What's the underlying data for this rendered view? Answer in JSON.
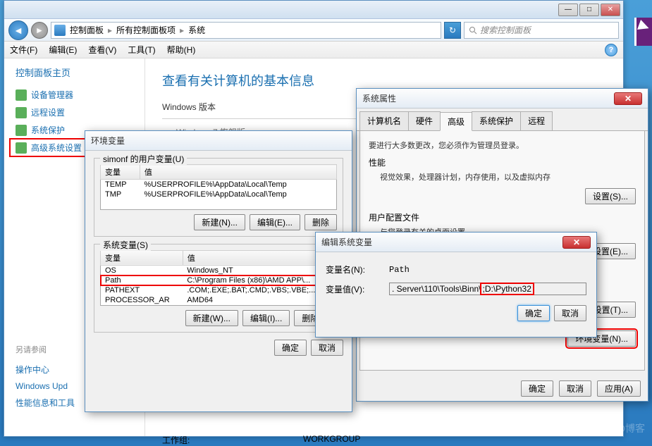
{
  "explorer": {
    "breadcrumb": [
      "控制面板",
      "所有控制面板项",
      "系统"
    ],
    "search_placeholder": "搜索控制面板",
    "menu": [
      "文件(F)",
      "编辑(E)",
      "查看(V)",
      "工具(T)",
      "帮助(H)"
    ]
  },
  "sidebar": {
    "title": "控制面板主页",
    "items": [
      "设备管理器",
      "远程设置",
      "系统保护",
      "高级系统设置"
    ],
    "see_also_title": "另请参阅",
    "see_also": [
      "操作中心",
      "Windows Upd",
      "性能信息和工具"
    ]
  },
  "content": {
    "heading": "查看有关计算机的基本信息",
    "section1": "Windows 版本",
    "edition": "Windows 7 旗舰版",
    "workgroup_label": "工作组:",
    "workgroup_value": "WORKGROUP"
  },
  "sysprop": {
    "title": "系统属性",
    "tabs": [
      "计算机名",
      "硬件",
      "高级",
      "系统保护",
      "远程"
    ],
    "intro": "要进行大多数更改，您必须作为管理员登录。",
    "perf_title": "性能",
    "perf_desc": "视觉效果，处理器计划，内存使用，以及虚拟内存",
    "userprof_title": "用户配置文件",
    "userprof_desc": "与您登录有关的桌面设置",
    "settings_btn": "设置(S)...",
    "settings_btn_e": "设置(E)...",
    "settings_btn_t": "设置(T)...",
    "envvar_btn": "环境变量(N)...",
    "ok": "确定",
    "cancel": "取消",
    "apply": "应用(A)"
  },
  "envvar": {
    "title": "环境变量",
    "user_group": "simonf 的用户变量(U)",
    "sys_group": "系统变量(S)",
    "col_var": "变量",
    "col_val": "值",
    "user_rows": [
      {
        "name": "TEMP",
        "val": "%USERPROFILE%\\AppData\\Local\\Temp"
      },
      {
        "name": "TMP",
        "val": "%USERPROFILE%\\AppData\\Local\\Temp"
      }
    ],
    "sys_rows": [
      {
        "name": "OS",
        "val": "Windows_NT"
      },
      {
        "name": "Path",
        "val": "C:\\Program Files (x86)\\AMD APP\\..."
      },
      {
        "name": "PATHEXT",
        "val": ".COM;.EXE;.BAT;.CMD;.VBS;.VBE;..."
      },
      {
        "name": "PROCESSOR_AR",
        "val": "AMD64"
      }
    ],
    "new_btn_n": "新建(N)...",
    "new_btn_w": "新建(W)...",
    "edit_btn_e": "编辑(E)...",
    "edit_btn_i": "编辑(I)...",
    "del_btn_d": "删除",
    "del_btn_l": "删除(L)",
    "ok": "确定",
    "cancel": "取消"
  },
  "editvar": {
    "title": "编辑系统变量",
    "name_label": "变量名(N):",
    "name_value": "Path",
    "val_label": "变量值(V):",
    "val_prefix": ". Server\\110\\Tools\\Binn\\",
    "val_highlight": ";D:\\Python32",
    "ok": "确定",
    "cancel": "取消"
  },
  "watermark": "@51CTO博客"
}
